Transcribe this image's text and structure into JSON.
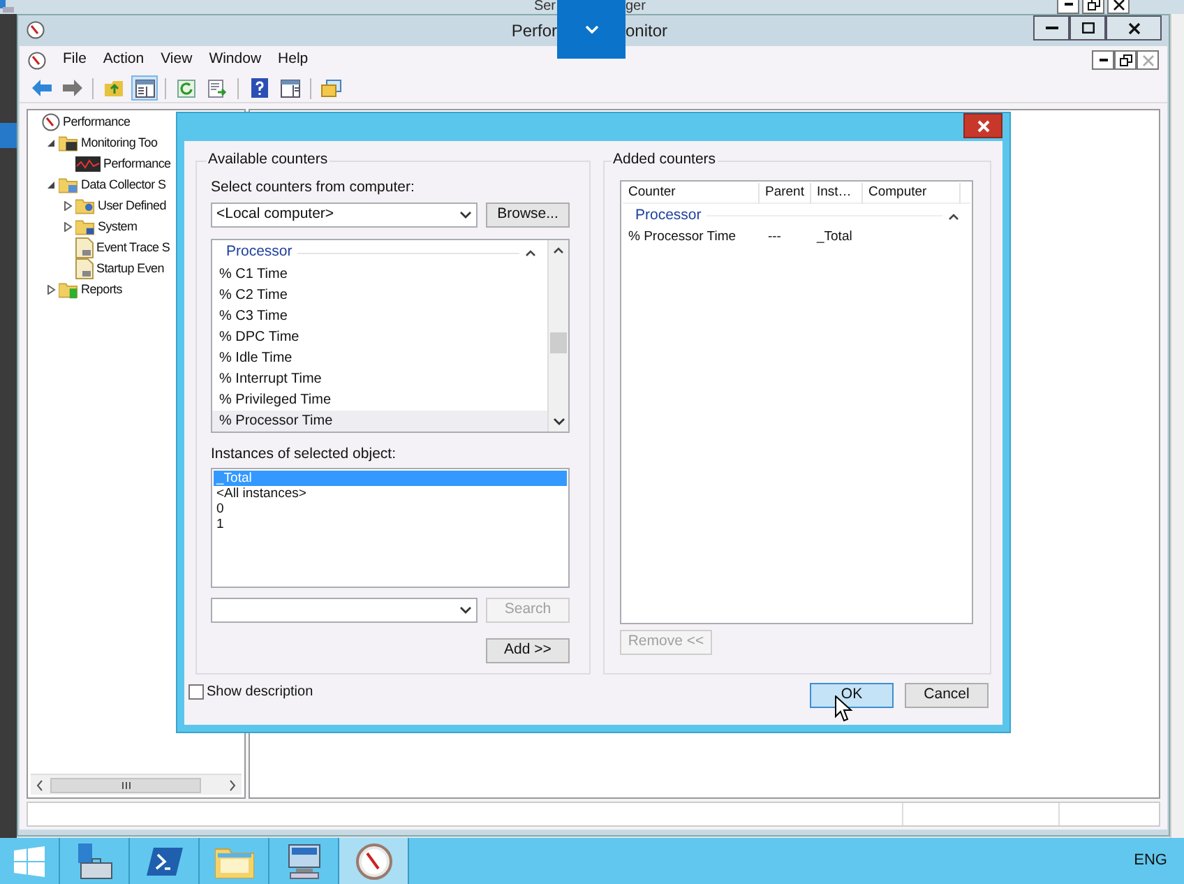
{
  "background_window": {
    "title_parts": [
      "Ser",
      "ger"
    ]
  },
  "window": {
    "title_parts": [
      "Perfor",
      "onitor"
    ]
  },
  "menu": [
    "File",
    "Action",
    "View",
    "Window",
    "Help"
  ],
  "toolbar": [
    {
      "kind": "back",
      "pressed": false
    },
    {
      "kind": "forward",
      "pressed": false
    },
    {
      "kind": "up",
      "pressed": false
    },
    {
      "kind": "tree",
      "pressed": true
    },
    {
      "kind": "refresh",
      "pressed": false
    },
    {
      "kind": "export",
      "pressed": false
    },
    {
      "kind": "help",
      "pressed": false
    },
    {
      "kind": "panel",
      "pressed": false
    },
    {
      "kind": "new",
      "pressed": false
    }
  ],
  "tree": [
    {
      "label": "Performance",
      "children": [
        {
          "label": "Monitoring Too",
          "expanded": true,
          "children": [
            {
              "label": "Performance"
            }
          ]
        },
        {
          "label": "Data Collector S",
          "expanded": true,
          "children": [
            {
              "label": "User Defined",
              "expanded": false
            },
            {
              "label": "System",
              "expanded": false
            },
            {
              "label": "Event Trace S"
            },
            {
              "label": "Startup Even"
            }
          ]
        },
        {
          "label": "Reports",
          "expanded": false
        }
      ]
    }
  ],
  "dialog": {
    "available": {
      "legend": "Available counters",
      "computer_label": "Select counters from computer:",
      "computer_value": "<Local computer>",
      "browse": "Browse...",
      "counter_group": {
        "label": "Processor",
        "expanded": true
      },
      "counters": [
        {
          "label": "% C1 Time",
          "selected": false
        },
        {
          "label": "% C2 Time",
          "selected": false
        },
        {
          "label": "% C3 Time",
          "selected": false
        },
        {
          "label": "% DPC Time",
          "selected": false
        },
        {
          "label": "% Idle Time",
          "selected": false
        },
        {
          "label": "% Interrupt Time",
          "selected": false
        },
        {
          "label": "% Privileged Time",
          "selected": false
        },
        {
          "label": "% Processor Time",
          "selected": true
        }
      ],
      "instances_label": "Instances of selected object:",
      "instances": [
        {
          "label": "_Total",
          "selected": true
        },
        {
          "label": "<All instances>",
          "selected": false
        },
        {
          "label": "0",
          "selected": false
        },
        {
          "label": "1",
          "selected": false
        }
      ],
      "search_button": {
        "label": "Search",
        "disabled": true
      },
      "add_button": {
        "label": "Add >>",
        "disabled": false
      }
    },
    "added": {
      "legend": "Added counters",
      "columns": [
        "Counter",
        "Parent",
        "Inst…",
        "Computer"
      ],
      "group": {
        "label": "Processor",
        "expanded": true
      },
      "rows": [
        {
          "counter": "% Processor Time",
          "parent": "---",
          "instance": "_Total"
        }
      ],
      "remove_button": {
        "label": "Remove <<",
        "disabled": true
      }
    },
    "show_description": {
      "label": "Show description",
      "checked": false
    },
    "buttons": [
      {
        "label": "OK",
        "default": true
      },
      {
        "label": "Cancel",
        "default": false
      }
    ]
  },
  "taskbar": {
    "items": [
      {
        "kind": "start",
        "active": false
      },
      {
        "kind": "server",
        "active": false
      },
      {
        "kind": "shell",
        "active": false
      },
      {
        "kind": "explorer",
        "active": false
      },
      {
        "kind": "computer",
        "active": false
      },
      {
        "kind": "gauge",
        "active": true
      }
    ],
    "language": "ENG"
  }
}
